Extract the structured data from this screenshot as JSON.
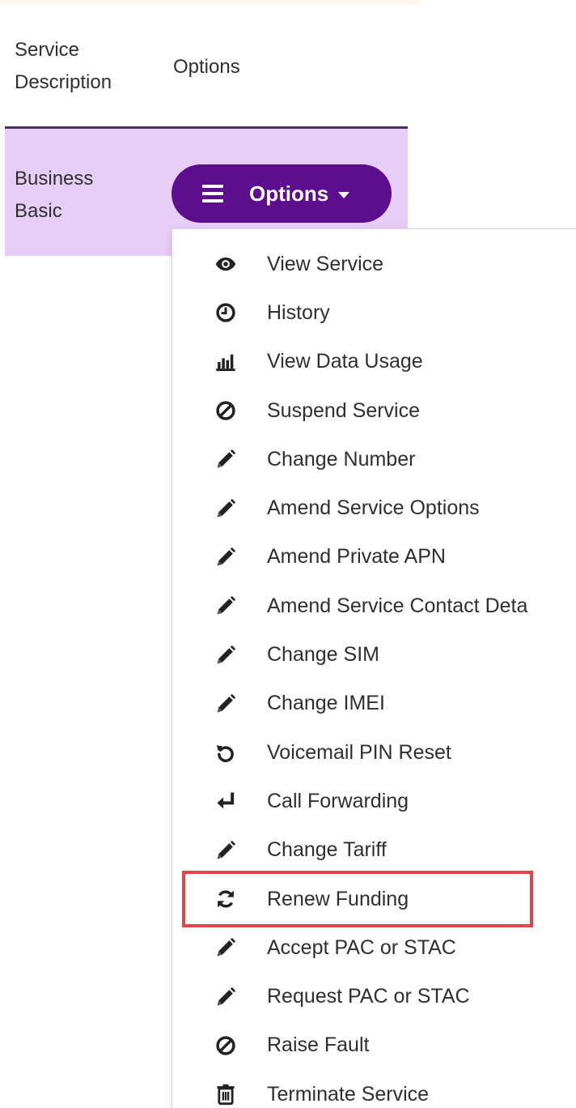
{
  "table": {
    "headers": {
      "service_description": "Service Description",
      "options": "Options"
    },
    "row": {
      "service_description": "Business Basic"
    },
    "options_button": {
      "label": "Options",
      "color": "#5c0e8e"
    },
    "row_highlight_color": "#e7cef9"
  },
  "dropdown": {
    "items": [
      {
        "label": "View Service",
        "icon": "eye-icon"
      },
      {
        "label": "History",
        "icon": "clock-icon"
      },
      {
        "label": "View Data Usage",
        "icon": "bar-chart-icon"
      },
      {
        "label": "Suspend Service",
        "icon": "ban-icon"
      },
      {
        "label": "Change Number",
        "icon": "pencil-icon"
      },
      {
        "label": "Amend Service Options",
        "icon": "pencil-icon"
      },
      {
        "label": "Amend Private APN",
        "icon": "pencil-icon"
      },
      {
        "label": "Amend Service Contact Deta",
        "icon": "pencil-icon"
      },
      {
        "label": "Change SIM",
        "icon": "pencil-icon"
      },
      {
        "label": "Change IMEI",
        "icon": "pencil-icon"
      },
      {
        "label": "Voicemail PIN Reset",
        "icon": "undo-icon"
      },
      {
        "label": "Call Forwarding",
        "icon": "return-arrow-icon"
      },
      {
        "label": "Change Tariff",
        "icon": "pencil-icon"
      },
      {
        "label": "Renew Funding",
        "icon": "refresh-icon",
        "highlighted": true
      },
      {
        "label": "Accept PAC or STAC",
        "icon": "pencil-icon"
      },
      {
        "label": "Request PAC or STAC",
        "icon": "pencil-icon"
      },
      {
        "label": "Raise Fault",
        "icon": "ban-icon"
      },
      {
        "label": "Terminate Service",
        "icon": "trash-icon"
      }
    ],
    "highlight_color": "#e0464a"
  }
}
